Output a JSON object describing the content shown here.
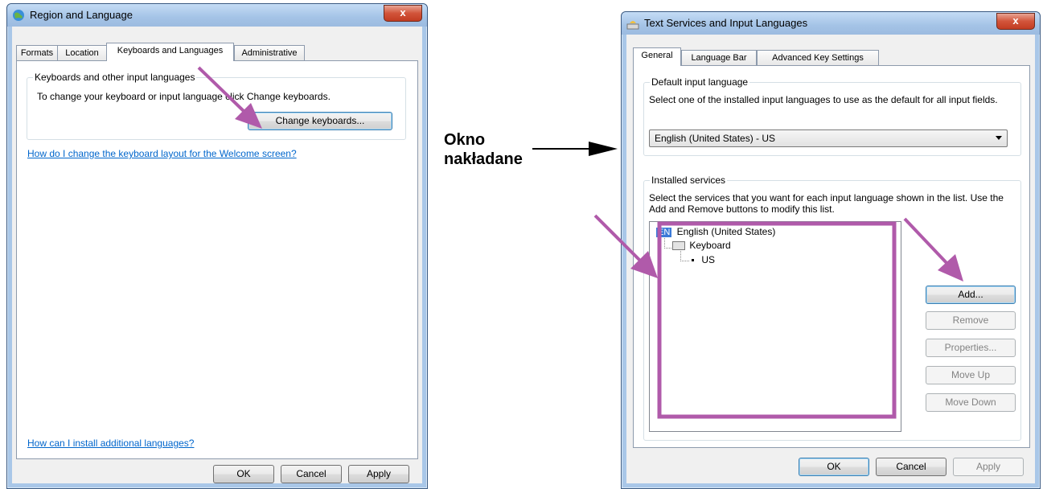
{
  "left_window": {
    "title": "Region and Language",
    "close_label": "x",
    "tabs": [
      {
        "label": "Formats"
      },
      {
        "label": "Location"
      },
      {
        "label": "Keyboards and Languages"
      },
      {
        "label": "Administrative"
      }
    ],
    "group_title": "Keyboards and other input languages",
    "group_text": "To change your keyboard or input language click Change keyboards.",
    "change_keyboards_button": "Change keyboards...",
    "welcome_link": "How do I change the keyboard layout for the Welcome screen?",
    "install_link": "How can I install additional languages?",
    "buttons": {
      "ok": "OK",
      "cancel": "Cancel",
      "apply": "Apply"
    }
  },
  "annotation": {
    "line1": "Okno",
    "line2": "nakładane",
    "arrow_color": "#b05aaa"
  },
  "right_window": {
    "title": "Text Services and Input Languages",
    "close_label": "x",
    "tabs": [
      {
        "label": "General"
      },
      {
        "label": "Language Bar"
      },
      {
        "label": "Advanced Key Settings"
      }
    ],
    "default_group_title": "Default input language",
    "default_group_text": "Select one of the installed input languages to use as the default for all input fields.",
    "default_select_value": "English (United States) - US",
    "installed_group_title": "Installed services",
    "installed_group_text": "Select the services that you want for each input language shown in the list. Use the Add and Remove buttons to modify this list.",
    "tree": {
      "lang_badge": "EN",
      "language": "English (United States)",
      "category": "Keyboard",
      "layout": "US"
    },
    "side_buttons": {
      "add": "Add...",
      "remove": "Remove",
      "properties": "Properties...",
      "move_up": "Move Up",
      "move_down": "Move Down"
    },
    "buttons": {
      "ok": "OK",
      "cancel": "Cancel",
      "apply": "Apply"
    }
  }
}
